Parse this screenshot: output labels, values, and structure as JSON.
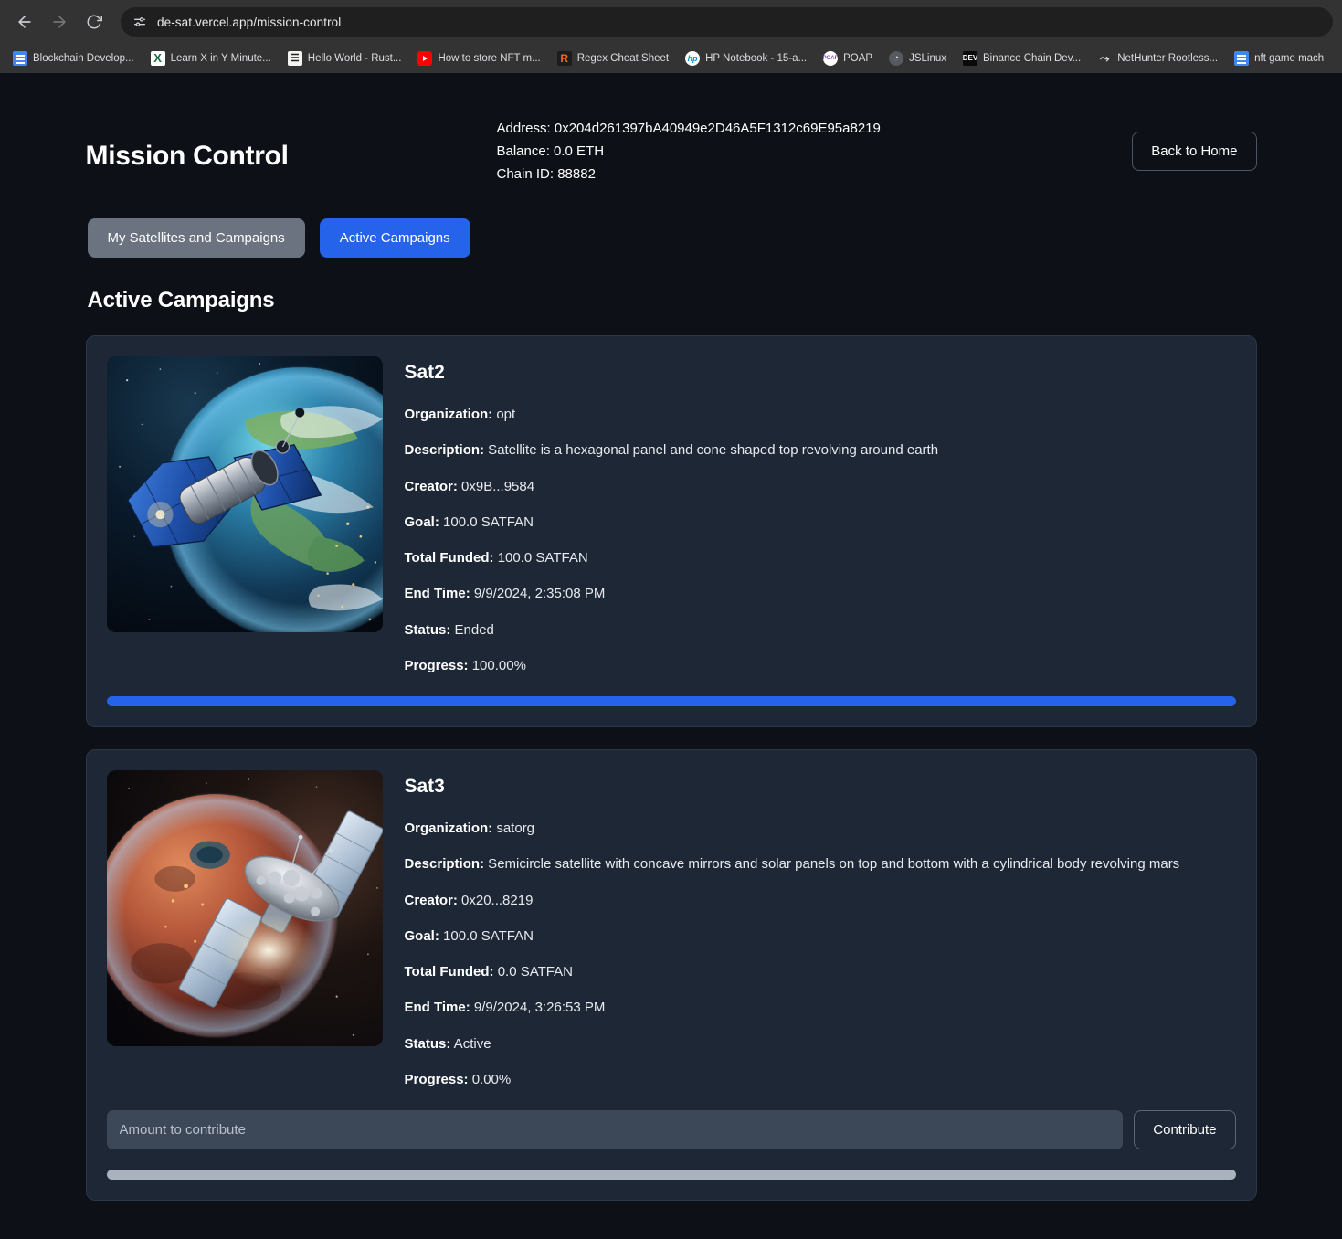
{
  "browser": {
    "url": "de-sat.vercel.app/mission-control",
    "nav": {
      "back": "back-arrow",
      "forward": "forward-arrow",
      "reload": "reload-arrow",
      "site_settings": "tune-icon"
    },
    "bookmarks": [
      {
        "label": "Blockchain Develop...",
        "icon": "docs-icon",
        "style": "fav-docs",
        "glyph": ""
      },
      {
        "label": "Learn X in Y Minute...",
        "icon": "x-icon",
        "style": "fav-x",
        "glyph": "X"
      },
      {
        "label": "Hello World - Rust...",
        "icon": "book-icon",
        "style": "fav-rust",
        "glyph": "☰"
      },
      {
        "label": "How to store NFT m...",
        "icon": "youtube-icon",
        "style": "fav-yt",
        "glyph": ""
      },
      {
        "label": "Regex Cheat Sheet",
        "icon": "regex-icon",
        "style": "fav-regex",
        "glyph": "R"
      },
      {
        "label": "HP Notebook - 15-a...",
        "icon": "hp-icon",
        "style": "fav-hp",
        "glyph": "hp"
      },
      {
        "label": "POAP",
        "icon": "poap-icon",
        "style": "fav-poap",
        "glyph": "POAP"
      },
      {
        "label": "JSLinux",
        "icon": "globe-icon",
        "style": "fav-js",
        "glyph": "◔"
      },
      {
        "label": "Binance Chain Dev...",
        "icon": "devto-icon",
        "style": "fav-dev",
        "glyph": "DEV"
      },
      {
        "label": "NetHunter Rootless...",
        "icon": "kali-dragon-icon",
        "style": "fav-kali",
        "glyph": "⤳"
      },
      {
        "label": "nft game mach",
        "icon": "docs-icon",
        "style": "fav-docs",
        "glyph": ""
      }
    ]
  },
  "header": {
    "title": "Mission Control",
    "wallet": {
      "address": "Address: 0x204d261397bA40949e2D46A5F1312c69E95a8219",
      "balance": "Balance: 0.0 ETH",
      "chain_id": "Chain ID: 88882"
    },
    "back_home_label": "Back to Home"
  },
  "tabs": {
    "my_satellites_label": "My Satellites and Campaigns",
    "active_campaigns_label": "Active Campaigns",
    "active_tab": "Active Campaigns"
  },
  "section": {
    "title": "Active Campaigns"
  },
  "labels": {
    "organization": "Organization:",
    "description": "Description:",
    "creator": "Creator:",
    "goal": "Goal:",
    "total_funded": "Total Funded:",
    "end_time": "End Time:",
    "status": "Status:",
    "progress": "Progress:"
  },
  "colors": {
    "accent_blue": "#2563eb",
    "tab_inactive": "#6b7280",
    "card_bg": "#1e2735",
    "page_bg": "#0d1117",
    "input_bg": "#3c4758",
    "progress_empty_track": "#aab2bd"
  },
  "campaigns": [
    {
      "name": "Sat2",
      "image": "earth-satellite-artwork",
      "organization": "opt",
      "description": "Satellite is a hexagonal panel and cone shaped top revolving around earth",
      "creator": "0x9B...9584",
      "goal": "100.0 SATFAN",
      "total_funded": "100.0 SATFAN",
      "end_time": "9/9/2024, 2:35:08 PM",
      "status": "Ended",
      "progress": "100.00%",
      "progress_value": 100,
      "has_contribute": false
    },
    {
      "name": "Sat3",
      "image": "mars-satellite-artwork",
      "organization": "satorg",
      "description": "Semicircle satellite with concave mirrors and solar panels on top and bottom with a cylindrical body revolving mars",
      "creator": "0x20...8219",
      "goal": "100.0 SATFAN",
      "total_funded": "0.0 SATFAN",
      "end_time": "9/9/2024, 3:26:53 PM",
      "status": "Active",
      "progress": "0.00%",
      "progress_value": 0,
      "has_contribute": true,
      "contribute_placeholder": "Amount to contribute",
      "contribute_button_label": "Contribute"
    }
  ]
}
